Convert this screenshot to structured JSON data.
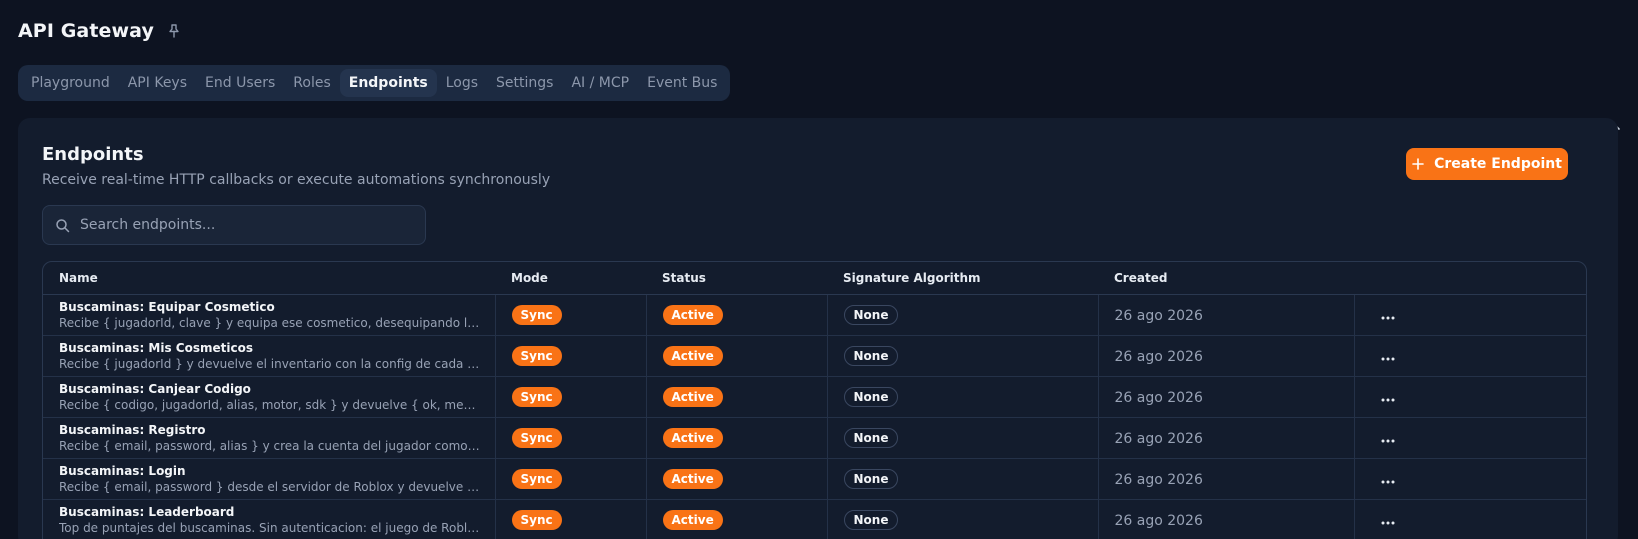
{
  "app": {
    "title": "API Gateway",
    "pin_icon": "pin-icon"
  },
  "tabs": [
    {
      "label": "Playground",
      "active": false
    },
    {
      "label": "API Keys",
      "active": false
    },
    {
      "label": "End Users",
      "active": false
    },
    {
      "label": "Roles",
      "active": false
    },
    {
      "label": "Endpoints",
      "active": true
    },
    {
      "label": "Logs",
      "active": false
    },
    {
      "label": "Settings",
      "active": false
    },
    {
      "label": "AI / MCP",
      "active": false
    },
    {
      "label": "Event Bus",
      "active": false
    }
  ],
  "panel": {
    "title": "Endpoints",
    "subtitle": "Receive real-time HTTP callbacks or execute automations synchronously",
    "create_label": "Create Endpoint"
  },
  "search": {
    "placeholder": "Search endpoints...",
    "value": ""
  },
  "table": {
    "headers": {
      "name": "Name",
      "mode": "Mode",
      "status": "Status",
      "algorithm": "Signature Algorithm",
      "created": "Created"
    },
    "rows": [
      {
        "name": "Buscaminas: Equipar Cosmetico",
        "desc": "Recibe { jugadorId, clave } y equipa ese cosmetico, desequipando los otros del mismo tipo.",
        "mode": "Sync",
        "status": "Active",
        "algorithm": "None",
        "created": "26 ago 2026"
      },
      {
        "name": "Buscaminas: Mis Cosmeticos",
        "desc": "Recibe { jugadorId } y devuelve el inventario con la config de cada cosmetico equipado.",
        "mode": "Sync",
        "status": "Active",
        "algorithm": "None",
        "created": "26 ago 2026"
      },
      {
        "name": "Buscaminas: Canjear Codigo",
        "desc": "Recibe { codigo, jugadorId, alias, motor, sdk } y devuelve { ok, mensaje, cosmetico }.",
        "mode": "Sync",
        "status": "Active",
        "algorithm": "None",
        "created": "26 ago 2026"
      },
      {
        "name": "Buscaminas: Registro",
        "desc": "Recibe { email, password, alias } y crea la cuenta del jugador como end user.",
        "mode": "Sync",
        "status": "Active",
        "algorithm": "None",
        "created": "26 ago 2026"
      },
      {
        "name": "Buscaminas: Login",
        "desc": "Recibe { email, password } desde el servidor de Roblox y devuelve { ok, usuario }.",
        "mode": "Sync",
        "status": "Active",
        "algorithm": "None",
        "created": "26 ago 2026"
      },
      {
        "name": "Buscaminas: Leaderboard",
        "desc": "Top de puntajes del buscaminas. Sin autenticacion: el juego de Roblox no envia credenciales.",
        "mode": "Sync",
        "status": "Active",
        "algorithm": "None",
        "created": "26 ago 2026"
      }
    ]
  },
  "colors": {
    "accent": "#f97316",
    "background": "#0d1321",
    "panel": "#131c2d"
  }
}
